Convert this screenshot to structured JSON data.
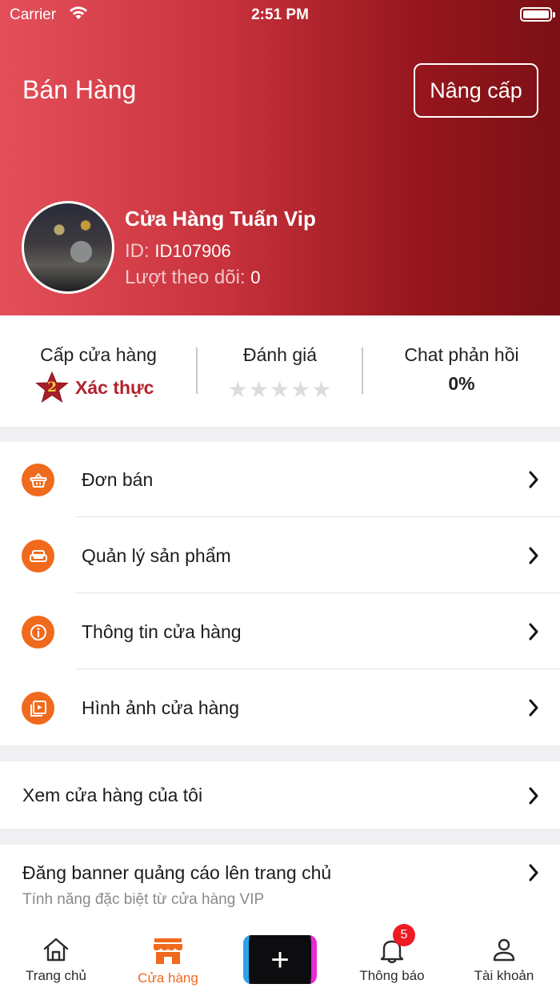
{
  "status_bar": {
    "carrier": "Carrier",
    "time": "2:51 PM"
  },
  "header": {
    "title": "Bán Hàng",
    "upgrade_label": "Nâng cấp",
    "shop_name": "Cửa Hàng Tuấn Vip",
    "id_label": "ID:",
    "id_value": "ID107906",
    "followers_label": "Lượt theo dõi:",
    "followers_value": "0"
  },
  "stats": {
    "level": {
      "title": "Cấp cửa hàng",
      "number": "2",
      "status": "Xác thực"
    },
    "rating": {
      "title": "Đánh giá",
      "stars": "★★★★★",
      "value": 0,
      "max": 5
    },
    "chat": {
      "title": "Chat phản hồi",
      "value": "0%"
    }
  },
  "menu": {
    "items": [
      {
        "label": "Đơn bán",
        "icon": "basket-icon"
      },
      {
        "label": "Quản lý sản phẩm",
        "icon": "sofa-icon"
      },
      {
        "label": "Thông tin cửa hàng",
        "icon": "info-icon"
      },
      {
        "label": "Hình ảnh cửa hàng",
        "icon": "gallery-icon"
      }
    ]
  },
  "view_shop": {
    "label": "Xem cửa hàng của tôi"
  },
  "banner": {
    "label": "Đăng banner quảng cáo lên trang chủ",
    "sub": "Tính năng đặc biệt từ cửa hàng VIP"
  },
  "tabbar": {
    "home": "Trang chủ",
    "shop": "Cửa hàng",
    "add": "+",
    "notifications": "Thông báo",
    "notifications_badge": "5",
    "account": "Tài khoản"
  },
  "colors": {
    "accent": "#f06a1d",
    "header_start": "#e4505a",
    "header_end": "#7b1015",
    "verified": "#b2232d",
    "badge": "#ee1b24"
  }
}
